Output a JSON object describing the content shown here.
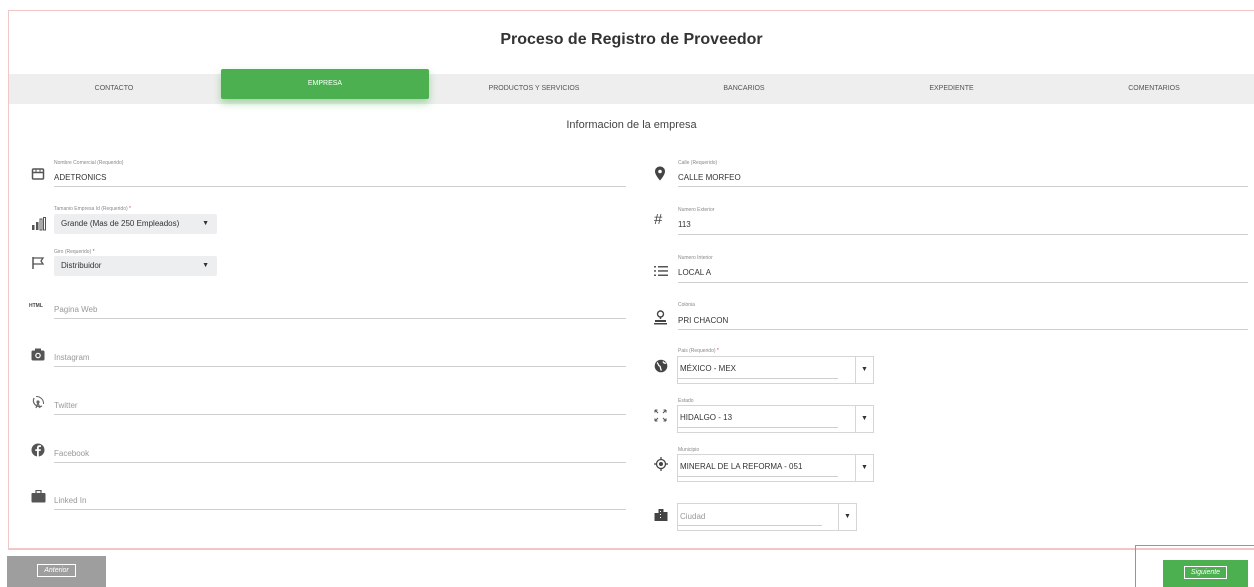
{
  "title": "Proceso de Registro de Proveedor",
  "tabs": [
    {
      "label": "CONTACTO"
    },
    {
      "label": "EMPRESA"
    },
    {
      "label": "PRODUCTOS Y SERVICIOS"
    },
    {
      "label": "BANCARIOS"
    },
    {
      "label": "EXPEDIENTE"
    },
    {
      "label": "COMENTARIOS"
    }
  ],
  "active_tab": "EMPRESA",
  "subtitle": "Informacion de la empresa",
  "left": {
    "nombre_comercial": {
      "label": "Nombre Comercial (Requerido)",
      "value": "ADETRONICS",
      "icon": "storefront-icon"
    },
    "tamanio": {
      "label": "Tamanio Empresa Id (Requerido)",
      "required_mark": "*",
      "value": "Grande (Mas de 250 Empleados)",
      "icon": "signal-icon"
    },
    "giro": {
      "label": "Giro (Requerido)",
      "required_mark": "*",
      "value": "Distribuidor",
      "icon": "flag-icon"
    },
    "pagina_web": {
      "placeholder": "Pagina Web",
      "icon_text": "HTML"
    },
    "instagram": {
      "placeholder": "Instagram",
      "icon": "camera-icon"
    },
    "twitter": {
      "placeholder": "Twitter",
      "icon": "satellite-dish-icon"
    },
    "facebook": {
      "placeholder": "Facebook",
      "icon": "facebook-icon"
    },
    "linkedin": {
      "placeholder": "Linked In",
      "icon": "briefcase-icon"
    }
  },
  "right": {
    "calle": {
      "label": "Calle (Requerido)",
      "value": "CALLE MORFEO",
      "icon": "location-pin-icon"
    },
    "numero_exterior": {
      "label": "Numero Exterior",
      "value": "113",
      "icon_text": "#"
    },
    "numero_interior": {
      "label": "Numero Interior",
      "value": "LOCAL A",
      "icon": "list-icon"
    },
    "colonia": {
      "label": "Colonia",
      "value": "PRI CHACON",
      "icon": "person-pin-icon"
    },
    "pais": {
      "label": "Pais (Requerido)",
      "required_mark": "*",
      "value": "MÉXICO - MEX",
      "icon": "globe-icon"
    },
    "estado": {
      "label": "Estado",
      "value": "HIDALGO - 13",
      "icon": "expand-icon"
    },
    "municipio": {
      "label": "Municipio",
      "value": "MINERAL DE LA REFORMA - 051",
      "icon": "gps-icon"
    },
    "ciudad": {
      "placeholder": "Ciudad",
      "icon": "city-icon"
    }
  },
  "caret": "▼",
  "nav": {
    "anterior": "Anterior",
    "siguiente": "Siguiente"
  },
  "colors": {
    "accent": "#4caf50",
    "tab_bar": "#eeeeee",
    "required": "#e53935",
    "anterior": "#9e9e9e"
  }
}
